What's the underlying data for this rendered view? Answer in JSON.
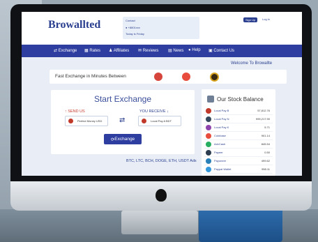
{
  "header": {
    "logo": "Browallted",
    "contact_lines": [
      "Contact",
      "● +8801xxx",
      "Today is Friday"
    ],
    "signup_label": "Sign Up",
    "login_label": "Log in"
  },
  "nav": {
    "items": [
      {
        "label": "Exchange",
        "icon": "exchange-icon"
      },
      {
        "label": "Rates",
        "icon": "rates-icon"
      },
      {
        "label": "Affiliates",
        "icon": "affiliates-icon"
      },
      {
        "label": "Reviews",
        "icon": "reviews-icon"
      },
      {
        "label": "News",
        "icon": "news-icon"
      },
      {
        "label": "Help",
        "icon": "help-icon"
      },
      {
        "label": "Contact Us",
        "icon": "contact-icon"
      }
    ]
  },
  "welcome": "Welcome To Browallte",
  "banner": {
    "text": "Fast Exchange in Minutes Between"
  },
  "exchange": {
    "title": "Start Exchange",
    "send_label": "SEND US",
    "receive_label": "YOU RECEIVE",
    "send_currency": "Perfect Money USD",
    "receive_currency": "Local Pay A BDT",
    "button_label": "Exchange"
  },
  "crypto_line": "BTC, LTC, BCH, DOGE, ETH, USDT Ads",
  "stock": {
    "title": "Our Stock Balance",
    "rows": [
      {
        "name": "Local Pay B",
        "value": "57,812.76",
        "color": "#c0392b"
      },
      {
        "name": "Local Pay N",
        "value": "999,217.90",
        "color": "#34495e"
      },
      {
        "name": "Local Pay K",
        "value": "5.71",
        "color": "#8e44ad"
      },
      {
        "name": "Coinbase",
        "value": "901.14",
        "color": "#e74c3c"
      },
      {
        "name": "AdvCash",
        "value": "845.54",
        "color": "#27ae60"
      },
      {
        "name": "Payeer",
        "value": "0.50",
        "color": "#2c3e50"
      },
      {
        "name": "Payoneer",
        "value": "499.62",
        "color": "#2980b9"
      },
      {
        "name": "Paypal Wallet",
        "value": "998.11",
        "color": "#3498db"
      }
    ]
  }
}
